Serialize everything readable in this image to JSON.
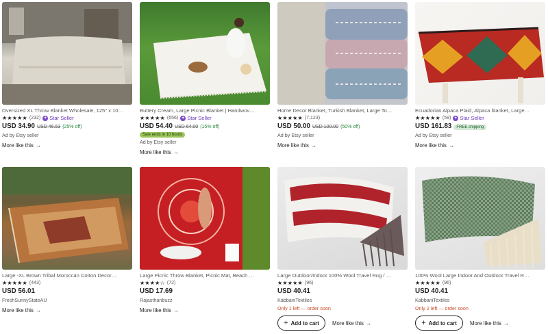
{
  "products": [
    {
      "title": "Oversized XL Throw Blanket Wholesale, 125\" x 10…",
      "stars": "★★★★★",
      "count": "(232)",
      "star_seller": "Star Seller",
      "price": "USD 34.90",
      "original_price": "USD 46.53",
      "discount": "(25% off)",
      "ad": "Ad by Etsy seller",
      "more": "More like this"
    },
    {
      "title": "Buttery Cream, Large Picnic Blanket | Handwov…",
      "stars": "★★★★★",
      "count": "(656)",
      "star_seller": "Star Seller",
      "price": "USD 54.40",
      "original_price": "USD 64.00",
      "discount": "(15% off)",
      "sale_badge": "Sale ends in 10 hours",
      "ad": "Ad by Etsy seller",
      "more": "More like this"
    },
    {
      "title": "Home Decor Blanket, Turkish Blanket, Large To…",
      "stars": "★★★★★",
      "count": "(7,123)",
      "price": "USD 50.00",
      "original_price": "USD 100.00",
      "discount": "(50% off)",
      "ad": "Ad by Etsy seller",
      "more": "More like this"
    },
    {
      "title": "Ecuadorian Alpaca Plaid, Alpaca blanket, Large…",
      "stars": "★★★★★",
      "count": "(59)",
      "star_seller": "Star Seller",
      "price": "USD 161.83",
      "shipping_badge": "FREE shipping",
      "ad": "Ad by Etsy seller",
      "more": "More like this"
    },
    {
      "title": "Large -XL Brown Tribal Moroccan Cotton Decor…",
      "stars": "★★★★★",
      "count": "(443)",
      "price": "USD 56.01",
      "shop": "FreshSunnyStateAU",
      "more": "More like this"
    },
    {
      "title": "Large Picnic Throw Blanket, Picnic Mat, Beach …",
      "stars": "★★★★☆",
      "count": "(72)",
      "price": "USD 17.69",
      "shop": "Rajasthanbuzz",
      "more": "More like this"
    },
    {
      "title": "Large Outdoor/Indoor 100% Wool Travel Rug / …",
      "stars": "★★★★★",
      "count": "(96)",
      "price": "USD 40.41",
      "shop": "KabbaniTextiles",
      "stock": "Only 1 left — order soon",
      "cart": "Add to cart",
      "more": "More like this"
    },
    {
      "title": "100% Wool Large Indoor And Outdoor Travel R…",
      "stars": "★★★★★",
      "count": "(96)",
      "price": "USD 40.41",
      "shop": "KabbaniTextiles",
      "stock": "Only 2 left — order soon",
      "cart": "Add to cart",
      "more": "More like this"
    }
  ],
  "colors": {
    "star_seller": "#6b35b8",
    "discount": "#258635",
    "stock_warning": "#c84b2b"
  },
  "icons": {
    "star_seller": "star-seller-icon",
    "arrow": "arrow-right-icon",
    "plus": "plus-icon"
  }
}
